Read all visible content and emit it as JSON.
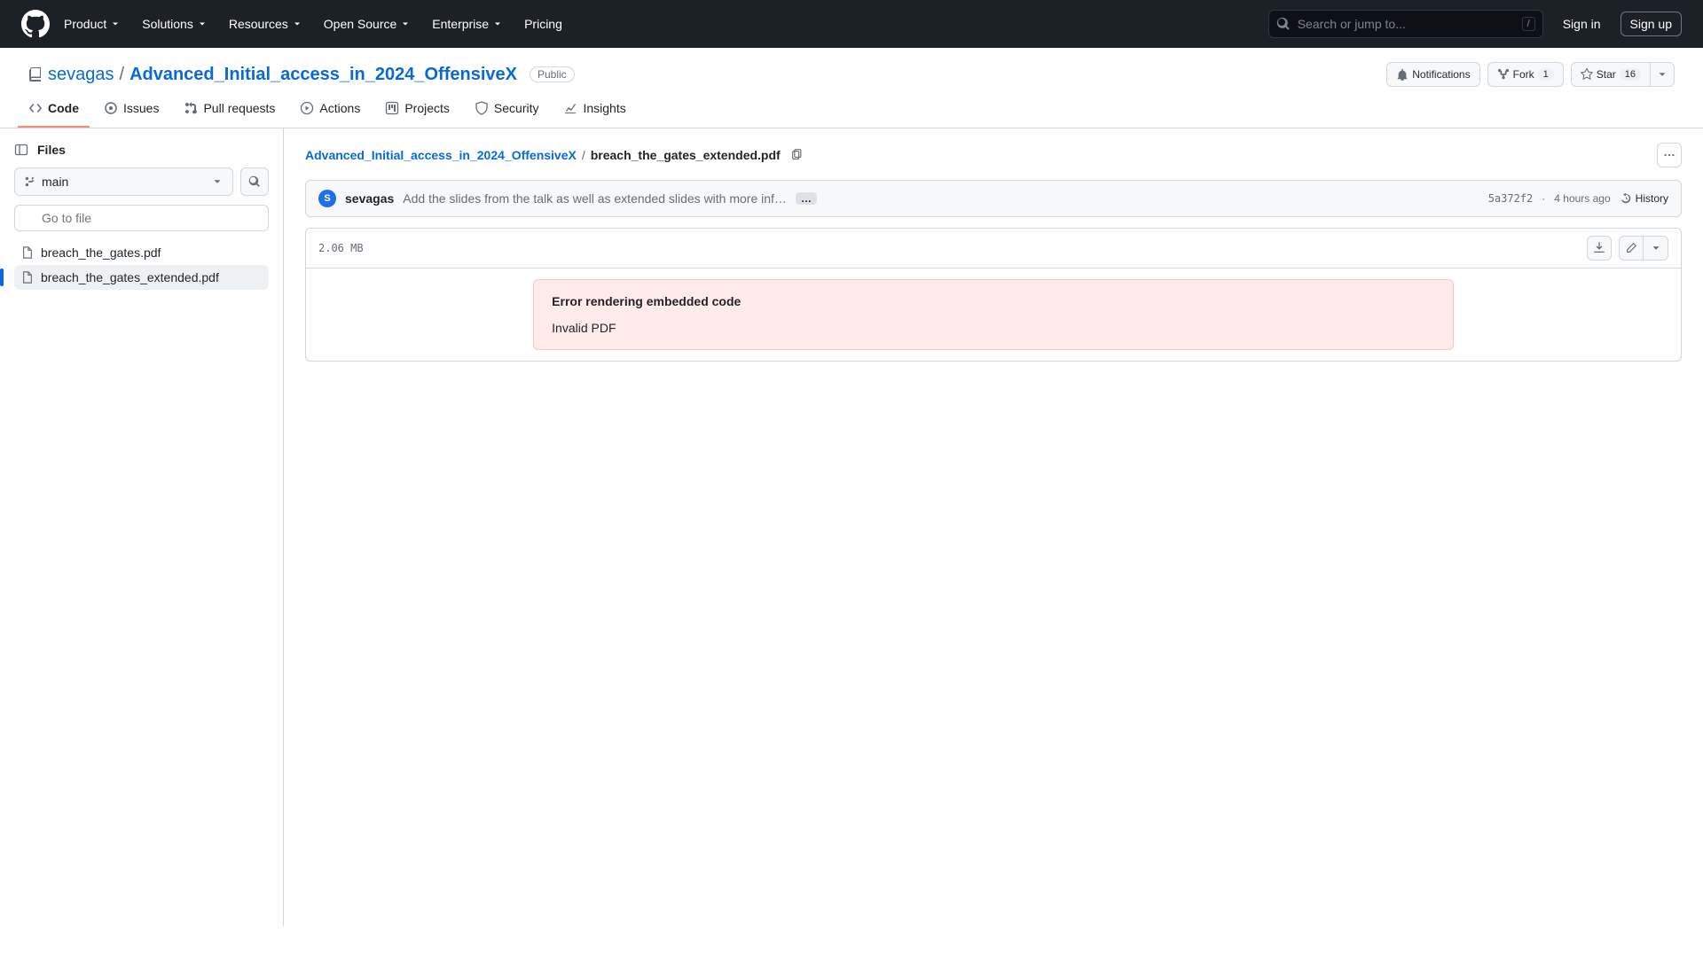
{
  "header": {
    "nav": [
      "Product",
      "Solutions",
      "Resources",
      "Open Source",
      "Enterprise"
    ],
    "pricing": "Pricing",
    "search_placeholder": "Search or jump to...",
    "search_key": "/",
    "signin": "Sign in",
    "signup": "Sign up"
  },
  "repo": {
    "owner": "sevagas",
    "name": "Advanced_Initial_access_in_2024_OffensiveX",
    "visibility": "Public",
    "actions": {
      "notifications": "Notifications",
      "fork_label": "Fork",
      "fork_count": "1",
      "star_label": "Star",
      "star_count": "16"
    }
  },
  "tabs": [
    "Code",
    "Issues",
    "Pull requests",
    "Actions",
    "Projects",
    "Security",
    "Insights"
  ],
  "sidebar": {
    "title": "Files",
    "branch": "main",
    "goto_placeholder": "Go to file",
    "files": [
      "breach_the_gates.pdf",
      "breach_the_gates_extended.pdf"
    ],
    "active_index": 1
  },
  "breadcrumb": {
    "root": "Advanced_Initial_access_in_2024_OffensiveX",
    "file": "breach_the_gates_extended.pdf"
  },
  "commit": {
    "author": "sevagas",
    "avatar_letter": "S",
    "message": "Add the slides from the talk as well as extended slides with more inf…",
    "sha": "5a372f2",
    "sep": "·",
    "time": "4 hours ago",
    "history": "History"
  },
  "file": {
    "size": "2.06 MB",
    "error_title": "Error rendering embedded code",
    "error_body": "Invalid PDF"
  }
}
